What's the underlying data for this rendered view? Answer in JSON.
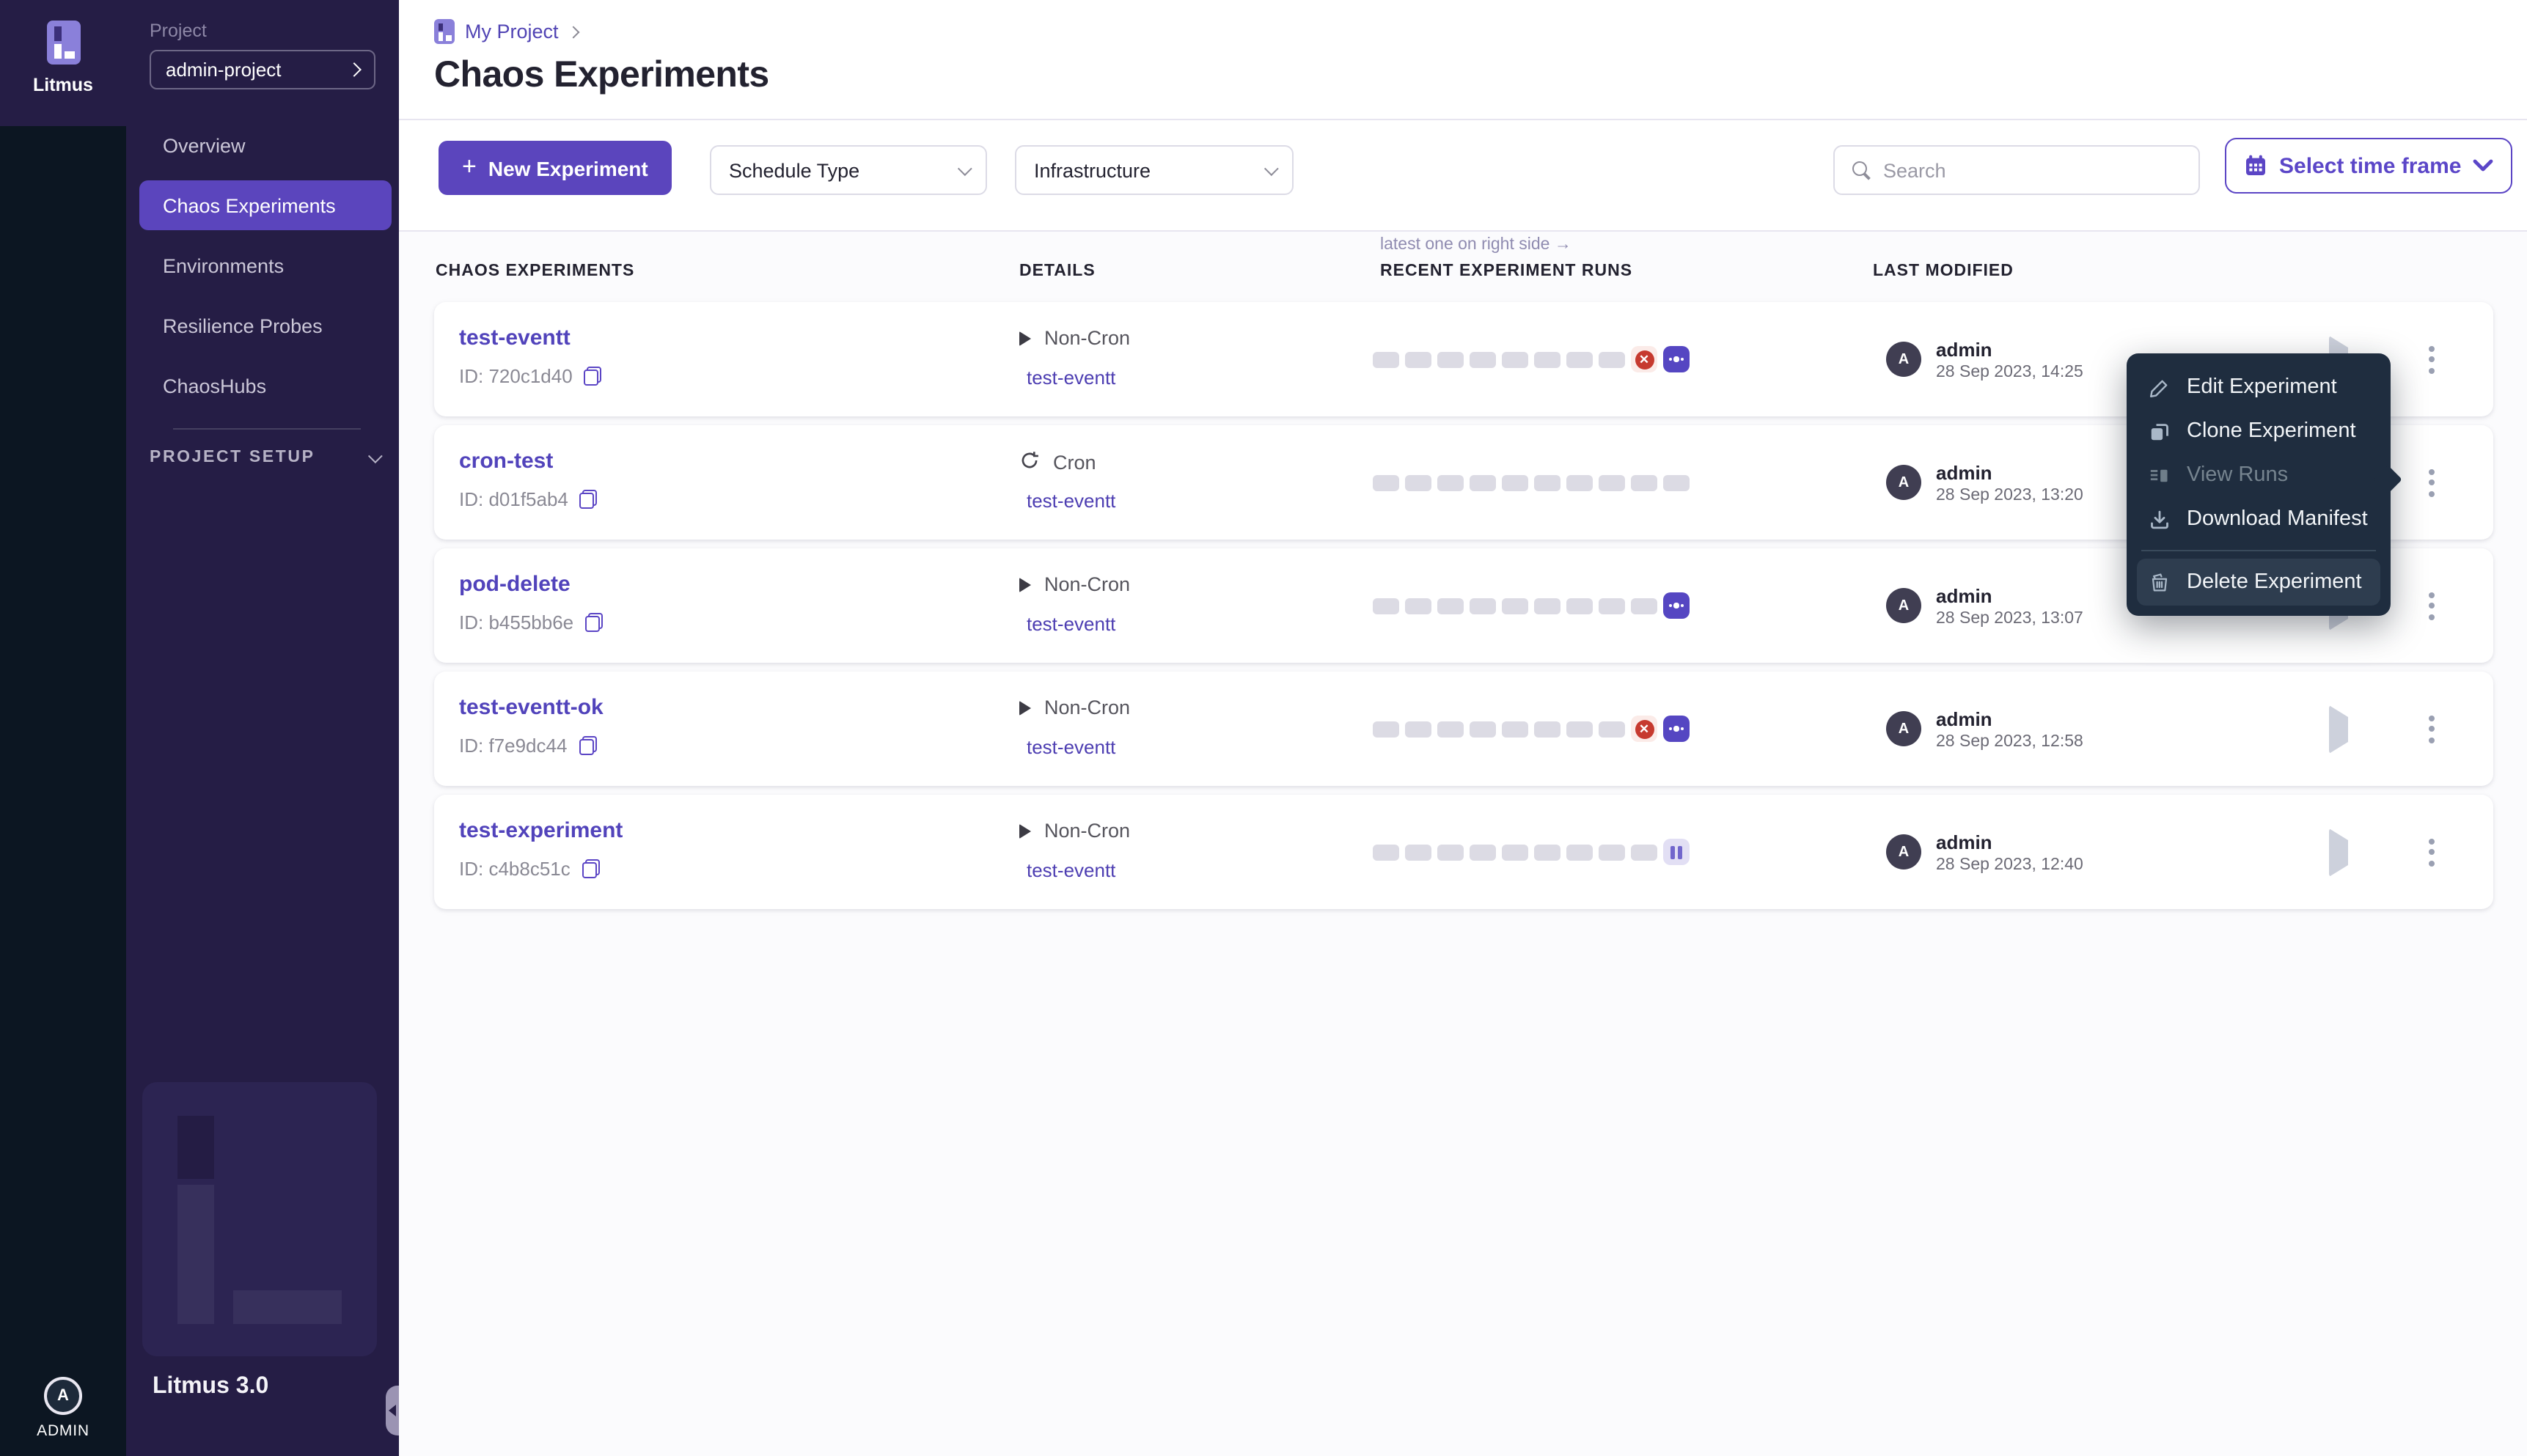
{
  "rail": {
    "brand": "Litmus",
    "user_label": "ADMIN",
    "avatar_letter": "A"
  },
  "sidebar": {
    "project_label": "Project",
    "project_name": "admin-project",
    "nav": [
      {
        "label": "Overview",
        "active": false
      },
      {
        "label": "Chaos Experiments",
        "active": true
      },
      {
        "label": "Environments",
        "active": false
      },
      {
        "label": "Resilience Probes",
        "active": false
      },
      {
        "label": "ChaosHubs",
        "active": false
      }
    ],
    "setup_label": "PROJECT SETUP",
    "version": "Litmus 3.0"
  },
  "breadcrumb": {
    "project": "My Project"
  },
  "page": {
    "title": "Chaos Experiments"
  },
  "toolbar": {
    "new_experiment": "New Experiment",
    "plus": "+",
    "schedule_type": "Schedule Type",
    "infrastructure": "Infrastructure",
    "search_placeholder": "Search",
    "time_frame": "Select time frame"
  },
  "table": {
    "runs_hint": "latest one on right side →",
    "headers": {
      "experiments": "CHAOS EXPERIMENTS",
      "details": "DETAILS",
      "runs": "RECENT EXPERIMENT RUNS",
      "modified": "LAST MODIFIED"
    },
    "rows": [
      {
        "name": "test-eventt",
        "id": "ID: 720c1d40",
        "schedule": "Non-Cron",
        "schedule_type": "non-cron",
        "infra": "test-eventt",
        "runs": [
          "empty",
          "empty",
          "empty",
          "empty",
          "empty",
          "empty",
          "empty",
          "empty",
          "failed",
          "more"
        ],
        "modified_by": "admin",
        "modified_at": "28 Sep 2023, 14:25"
      },
      {
        "name": "cron-test",
        "id": "ID: d01f5ab4",
        "schedule": "Cron",
        "schedule_type": "cron",
        "infra": "test-eventt",
        "runs": [
          "empty",
          "empty",
          "empty",
          "empty",
          "empty",
          "empty",
          "empty",
          "empty",
          "empty",
          "empty"
        ],
        "modified_by": "admin",
        "modified_at": "28 Sep 2023, 13:20"
      },
      {
        "name": "pod-delete",
        "id": "ID: b455bb6e",
        "schedule": "Non-Cron",
        "schedule_type": "non-cron",
        "infra": "test-eventt",
        "runs": [
          "empty",
          "empty",
          "empty",
          "empty",
          "empty",
          "empty",
          "empty",
          "empty",
          "empty",
          "more"
        ],
        "modified_by": "admin",
        "modified_at": "28 Sep 2023, 13:07"
      },
      {
        "name": "test-eventt-ok",
        "id": "ID: f7e9dc44",
        "schedule": "Non-Cron",
        "schedule_type": "non-cron",
        "infra": "test-eventt",
        "runs": [
          "empty",
          "empty",
          "empty",
          "empty",
          "empty",
          "empty",
          "empty",
          "empty",
          "failed",
          "more"
        ],
        "modified_by": "admin",
        "modified_at": "28 Sep 2023, 12:58"
      },
      {
        "name": "test-experiment",
        "id": "ID: c4b8c51c",
        "schedule": "Non-Cron",
        "schedule_type": "non-cron",
        "infra": "test-eventt",
        "runs": [
          "empty",
          "empty",
          "empty",
          "empty",
          "empty",
          "empty",
          "empty",
          "empty",
          "empty",
          "paused"
        ],
        "modified_by": "admin",
        "modified_at": "28 Sep 2023, 12:40"
      }
    ],
    "failed_glyph": "✕"
  },
  "menu": {
    "items": [
      {
        "label": "Edit Experiment",
        "icon": "pencil-icon",
        "disabled": false,
        "highlight": false
      },
      {
        "label": "Clone Experiment",
        "icon": "clone-icon",
        "disabled": false,
        "highlight": false
      },
      {
        "label": "View Runs",
        "icon": "runs-list-icon",
        "disabled": true,
        "highlight": false
      },
      {
        "label": "Download Manifest",
        "icon": "download-icon",
        "disabled": false,
        "highlight": false
      },
      {
        "label": "Delete Experiment",
        "icon": "trash-icon",
        "disabled": false,
        "highlight": true
      }
    ]
  }
}
